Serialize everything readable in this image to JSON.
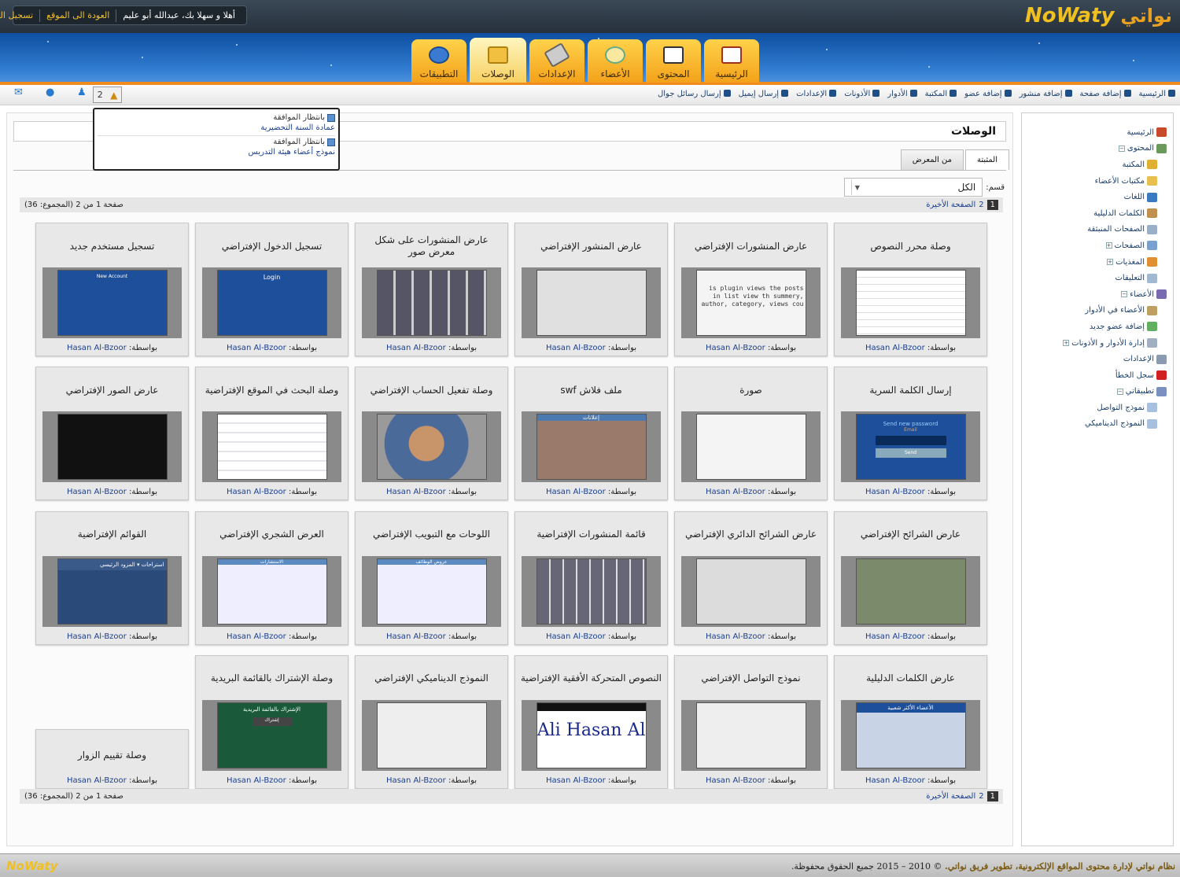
{
  "header": {
    "logo_latin": "NoWaty",
    "logo_arabic": "نواتي",
    "welcome": "أهلا و سهلا بك، عبدالله أبو عليم",
    "back_to_site": "العودة الى الموقع",
    "logout": "تسجيل الخروج"
  },
  "main_tabs": [
    {
      "label": "الرئيسية",
      "icon": "home-icon"
    },
    {
      "label": "المحتوى",
      "icon": "content-icon"
    },
    {
      "label": "الأعضاء",
      "icon": "members-icon"
    },
    {
      "label": "الإعدادات",
      "icon": "tools-icon"
    },
    {
      "label": "الوصلات",
      "icon": "puzzle-icon"
    },
    {
      "label": "التطبيقات",
      "icon": "globe-icon"
    }
  ],
  "active_tab": "الوصلات",
  "navbar": {
    "links": [
      "الرئيسية",
      "إضافة صفحة",
      "إضافة منشور",
      "إضافة عضو",
      "المكتبة",
      "الأدوار",
      "الأذونات",
      "الإعدادات",
      "إرسال إيميل",
      "إرسال رسائل جوال"
    ],
    "notification_count": "2"
  },
  "notifications": [
    {
      "status": "بانتظار الموافقة",
      "title": "عمادة السنة التحضيرية"
    },
    {
      "status": "بانتظار الموافقة",
      "title": "نموذج أعضاء هيئة التدريس"
    }
  ],
  "page": {
    "title": "الوصلات",
    "subtabs": [
      "المثبتة",
      "من المعرض"
    ],
    "filter_label": "قسم:",
    "filter_value": "الكل",
    "pager_info": "صفحة 1 من 2 (المجموع: 36)",
    "pager_current": "1",
    "pager_next": "2",
    "pager_last": "الصفحة الأخيرة",
    "by_label": "بواسطة:",
    "author": "Hasan Al-Bzoor"
  },
  "plugins": [
    {
      "title": "وصلة محرر النصوص"
    },
    {
      "title": "عارض المنشورات الإفتراضي"
    },
    {
      "title": "عارض المنشور الإفتراضي"
    },
    {
      "title": "عارض المنشورات على شكل معرض صور"
    },
    {
      "title": "تسجيل الدخول الإفتراضي"
    },
    {
      "title": "تسجيل مستخدم جديد"
    },
    {
      "title": "إرسال الكلمة السرية"
    },
    {
      "title": "صورة"
    },
    {
      "title": "ملف فلاش swf"
    },
    {
      "title": "وصلة تفعيل الحساب الإفتراضي"
    },
    {
      "title": "وصلة البحث في الموقع الإفتراضية"
    },
    {
      "title": "عارض الصور الإفتراضي"
    },
    {
      "title": "عارض الشرائح الإفتراضي"
    },
    {
      "title": "عارض الشرائح الدائري الإفتراضي"
    },
    {
      "title": "قائمة المنشورات الإفتراضية"
    },
    {
      "title": "اللوحات مع التبويب الإفتراضي"
    },
    {
      "title": "العرض الشجري الإفتراضي"
    },
    {
      "title": "القوائم الإفتراضية"
    },
    {
      "title": "عارض الكلمات الدليلية"
    },
    {
      "title": "نموذج التواصل الإفتراضي"
    },
    {
      "title": "النصوص المتحركة الأفقية الإفتراضية"
    },
    {
      "title": "النموذج الديناميكي الإفتراضي"
    },
    {
      "title": "وصلة الإشتراك بالقائمة البريدية"
    },
    {
      "title": "وصلة تقييم الزوار"
    }
  ],
  "preview_text": {
    "new_account": "New Account",
    "login": "Login",
    "send_new_password": "Send new password",
    "email": "Email",
    "send": "Send",
    "plugin_desc": "is plugin views the posts in list view th summery, author, category, views cou",
    "marquee": "Ali Hasan Al-",
    "subscribe": "الإشتراك بالقائمة البريدية",
    "subscribe_btn": "إشتراك",
    "flash": "إعلانات",
    "tag_header": "الأعضاء الأكثر شعبية",
    "menu_a": "استراحات",
    "menu_b": "المزود الرئيسي",
    "tree_header": "الاستشارات",
    "gallery_header": "عروض الوظائف"
  },
  "sidebar": {
    "items": [
      {
        "label": "الرئيسية",
        "level": 0,
        "toggle": ""
      },
      {
        "label": "المحتوى",
        "level": 0,
        "toggle": "−"
      },
      {
        "label": "المكتبة",
        "level": 1,
        "toggle": ""
      },
      {
        "label": "مكتبات الأعضاء",
        "level": 1,
        "toggle": ""
      },
      {
        "label": "اللغات",
        "level": 1,
        "toggle": ""
      },
      {
        "label": "الكلمات الدليلية",
        "level": 1,
        "toggle": ""
      },
      {
        "label": "الصفحات المنبثقة",
        "level": 1,
        "toggle": ""
      },
      {
        "label": "الصفحات",
        "level": 1,
        "toggle": "+"
      },
      {
        "label": "المغذيات",
        "level": 1,
        "toggle": "+"
      },
      {
        "label": "التعليقات",
        "level": 1,
        "toggle": ""
      },
      {
        "label": "الأعضاء",
        "level": 0,
        "toggle": "−"
      },
      {
        "label": "الأعضاء في الأدوار",
        "level": 1,
        "toggle": ""
      },
      {
        "label": "إضافة عضو جديد",
        "level": 1,
        "toggle": ""
      },
      {
        "label": "إدارة الأدوار و الأذونات",
        "level": 1,
        "toggle": "+"
      },
      {
        "label": "الإعدادات",
        "level": 0,
        "toggle": ""
      },
      {
        "label": "سجل الخطأ",
        "level": 0,
        "toggle": ""
      },
      {
        "label": "تطبيقاتي",
        "level": 0,
        "toggle": "−"
      },
      {
        "label": "نموذج التواصل",
        "level": 1,
        "toggle": ""
      },
      {
        "label": "النموذج الديناميكي",
        "level": 1,
        "toggle": ""
      }
    ]
  },
  "footer": {
    "text_main": "نظام نواتي لإدارة محتوى المواقع الإلكترونية، تطوير فريق نواتي.",
    "copyright": "© 2010 – 2015 جميع الحقوق محفوظة."
  },
  "colors": {
    "accent_orange": "#f08c1e",
    "link_blue": "#1a3f8e",
    "tab_gold": "#f3a21a"
  }
}
